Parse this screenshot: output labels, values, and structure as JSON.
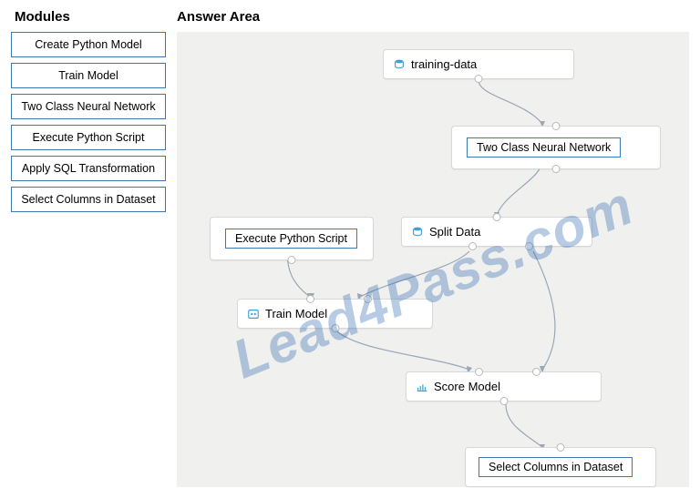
{
  "sidebar": {
    "title": "Modules",
    "items": [
      "Create Python Model",
      "Train Model",
      "Two Class Neural Network",
      "Execute Python Script",
      "Apply SQL Transformation",
      "Select Columns in Dataset"
    ]
  },
  "answer": {
    "title": "Answer Area"
  },
  "nodes": {
    "training_data": {
      "label": "training-data"
    },
    "two_class_nn": {
      "tag": "Two Class Neural Network"
    },
    "split_data": {
      "label": "Split Data"
    },
    "exec_py": {
      "tag": "Execute Python Script"
    },
    "train_model": {
      "label": "Train Model"
    },
    "score_model": {
      "label": "Score Model"
    },
    "select_cols": {
      "tag": "Select Columns in Dataset"
    }
  },
  "watermark": "Lead4Pass.com"
}
